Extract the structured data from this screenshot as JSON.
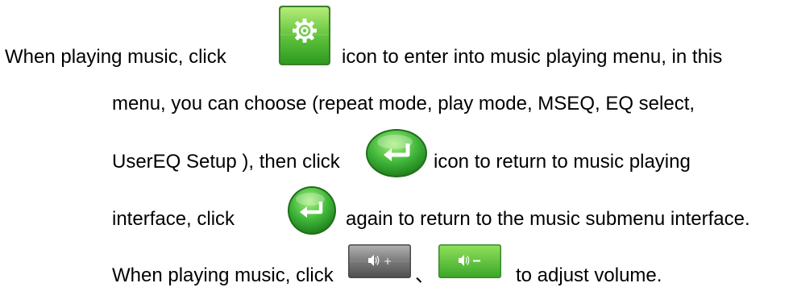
{
  "instructions": {
    "line1_a": "When playing music, click",
    "line1_b": "icon to enter into music playing menu, in this",
    "line2": "menu, you can choose (repeat mode, play mode, MSEQ, EQ select,",
    "line3_a": "UserEQ Setup ), then click",
    "line3_b": "icon to return to music playing",
    "line4_a": "interface, click",
    "line4_b": "again to return to the music submenu interface.",
    "line5_a": "When playing music, click",
    "line5_sep": "、",
    "line5_b": "to adjust volume."
  },
  "icons": {
    "settings": "gear-icon",
    "return": "return-arrow-icon",
    "volume_up": "volume-up-icon",
    "volume_down": "volume-down-icon"
  },
  "colors": {
    "green_button_light": "#8fd65a",
    "green_button_dark": "#2e9a22",
    "grey_button_light": "#9a9a9a",
    "grey_button_dark": "#5e5e5e",
    "text": "#000000"
  }
}
